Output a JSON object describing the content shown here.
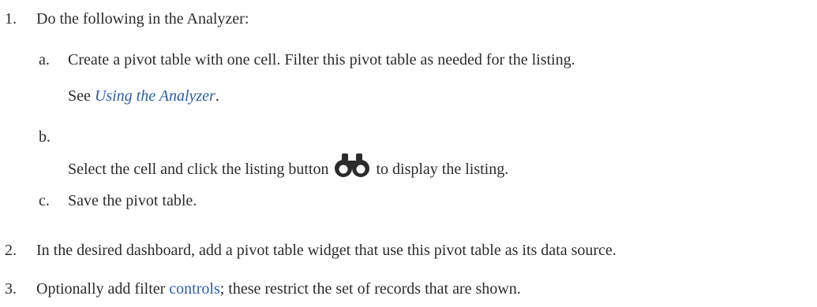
{
  "steps": [
    {
      "number": "1.",
      "text": "Do the following in the Analyzer:",
      "substeps": [
        {
          "letter": "a.",
          "text": "Create a pivot table with one cell. Filter this pivot table as needed for the listing.",
          "see_prefix": "See ",
          "see_link": "Using the Analyzer",
          "see_suffix": "."
        },
        {
          "letter": "b.",
          "text_before": "Select the cell and click the listing button",
          "icon": "binoculars-icon",
          "text_after": "to display the listing."
        },
        {
          "letter": "c.",
          "text": "Save the pivot table."
        }
      ]
    },
    {
      "number": "2.",
      "text": "In the desired dashboard, add a pivot table widget that use this pivot table as its data source."
    },
    {
      "number": "3.",
      "text_before": "Optionally add filter ",
      "link": "controls",
      "text_after": "; these restrict the set of records that are shown."
    }
  ],
  "colors": {
    "text": "#2b2b2b",
    "link": "#2a5db0"
  }
}
